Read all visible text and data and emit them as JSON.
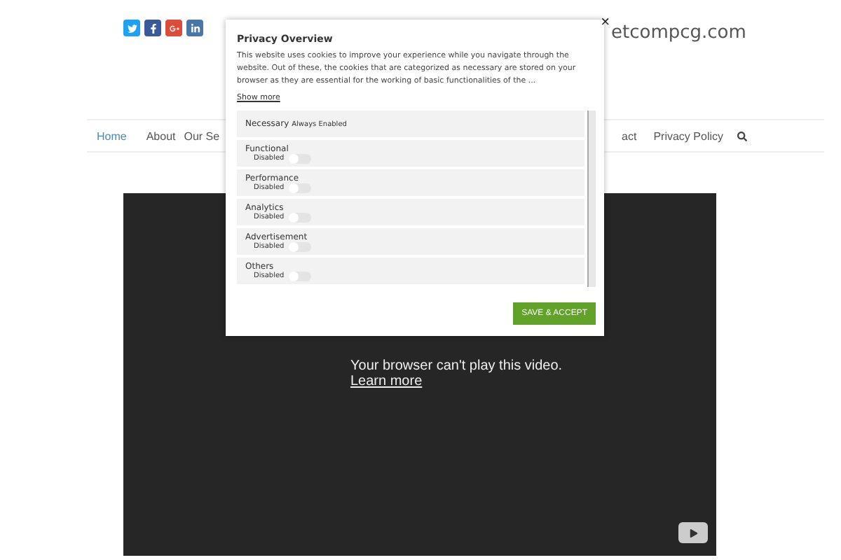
{
  "header": {
    "social": [
      {
        "kind": "twitter",
        "color": "#1da1f2"
      },
      {
        "kind": "facebook",
        "color": "#3b5998"
      },
      {
        "kind": "google",
        "color": "#dd4b39"
      },
      {
        "kind": "linkedin",
        "color": "#4a76a8"
      }
    ],
    "site_name": "etcompcg.com"
  },
  "nav": {
    "items": [
      {
        "label": "Home",
        "selected": true
      },
      {
        "label": "About",
        "selected": false
      },
      {
        "label": "Our Se",
        "selected": false
      },
      {
        "label": "act",
        "selected": false
      },
      {
        "label": "Privacy Policy",
        "selected": false
      }
    ]
  },
  "video": {
    "message": "Your browser can't play this video.",
    "link": "Learn more"
  },
  "modal": {
    "title": "Privacy Overview",
    "text": "This website uses cookies to improve your experience while you navigate through the website. Out of these, the cookies that are categorized as necessary are stored on your browser as they are essential for the working of basic functionalities of the ...",
    "show_more": "Show more",
    "close": "×",
    "categories": [
      {
        "kind": "fixed",
        "name": "Necessary",
        "status": "Always Enabled"
      },
      {
        "kind": "toggle",
        "name": "Functional",
        "status": "Disabled",
        "on": false
      },
      {
        "kind": "toggle",
        "name": "Performance",
        "status": "Disabled",
        "on": false
      },
      {
        "kind": "toggle",
        "name": "Analytics",
        "status": "Disabled",
        "on": false
      },
      {
        "kind": "toggle",
        "name": "Advertisement",
        "status": "Disabled",
        "on": false
      },
      {
        "kind": "toggle",
        "name": "Others",
        "status": "Disabled",
        "on": false
      }
    ],
    "button": "SAVE & ACCEPT"
  }
}
